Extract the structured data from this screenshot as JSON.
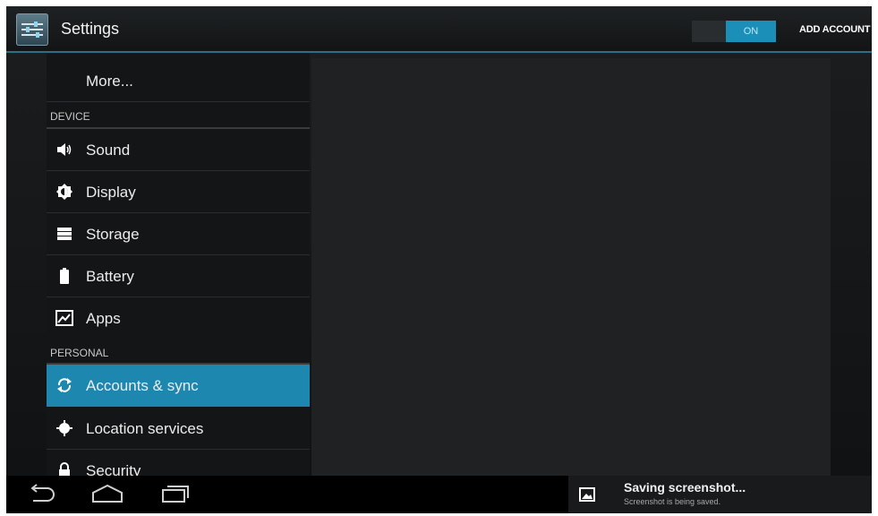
{
  "actionbar": {
    "title": "Settings",
    "app_icon": "settings-sliders-icon",
    "toggle_label": "ON",
    "add_account_label": "ADD ACCOUNT",
    "accent": "#1c8fb8"
  },
  "list": {
    "more_label": "More...",
    "device_header": "DEVICE",
    "personal_header": "PERSONAL",
    "device_items": [
      {
        "label": "Sound",
        "icon": "speaker-icon"
      },
      {
        "label": "Display",
        "icon": "brightness-icon"
      },
      {
        "label": "Storage",
        "icon": "storage-icon"
      },
      {
        "label": "Battery",
        "icon": "battery-icon"
      },
      {
        "label": "Apps",
        "icon": "apps-icon"
      }
    ],
    "personal_items": [
      {
        "label": "Accounts & sync",
        "icon": "sync-icon",
        "selected": true
      },
      {
        "label": "Location services",
        "icon": "location-icon"
      },
      {
        "label": "Security",
        "icon": "lock-icon"
      }
    ]
  },
  "navbar": {
    "back": "back-icon",
    "home": "home-icon",
    "recents": "recent-apps-icon"
  },
  "notification": {
    "title": "Saving screenshot...",
    "subtitle": "Screenshot is being saved.",
    "icon": "picture-icon"
  }
}
